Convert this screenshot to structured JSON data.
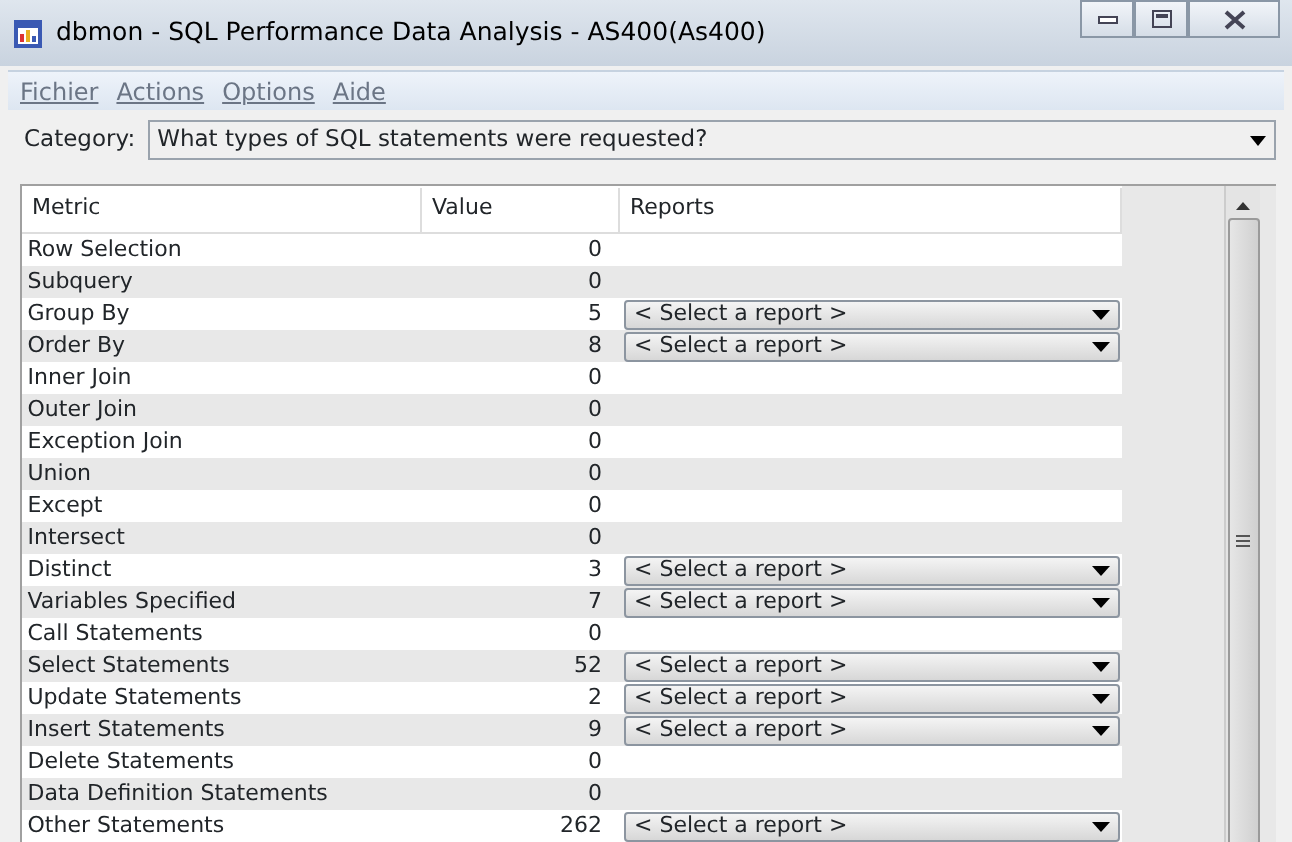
{
  "window": {
    "title": "dbmon - SQL Performance Data Analysis - AS400(As400)"
  },
  "menu": [
    {
      "label": "Fichier"
    },
    {
      "label": "Actions"
    },
    {
      "label": "Options"
    },
    {
      "label": "Aide"
    }
  ],
  "category": {
    "label": "Category:",
    "value": "What types of SQL statements were requested?"
  },
  "table": {
    "columns": [
      "Metric",
      "Value",
      "Reports"
    ],
    "rows": [
      {
        "metric": "Row Selection",
        "value": "0"
      },
      {
        "metric": "Subquery",
        "value": "0"
      },
      {
        "metric": "Group By",
        "value": "5",
        "report": "< Select a report >"
      },
      {
        "metric": "Order By",
        "value": "8",
        "report": "< Select a report >"
      },
      {
        "metric": "Inner Join",
        "value": "0"
      },
      {
        "metric": "Outer Join",
        "value": "0"
      },
      {
        "metric": "Exception Join",
        "value": "0"
      },
      {
        "metric": "Union",
        "value": "0"
      },
      {
        "metric": "Except",
        "value": "0"
      },
      {
        "metric": "Intersect",
        "value": "0"
      },
      {
        "metric": "Distinct",
        "value": "3",
        "report": "< Select a report >"
      },
      {
        "metric": "Variables Specified",
        "value": "7",
        "report": "< Select a report >"
      },
      {
        "metric": "Call Statements",
        "value": "0"
      },
      {
        "metric": "Select Statements",
        "value": "52",
        "report": "< Select a report >"
      },
      {
        "metric": "Update Statements",
        "value": "2",
        "report": "< Select a report >"
      },
      {
        "metric": "Insert Statements",
        "value": "9",
        "report": "< Select a report >"
      },
      {
        "metric": "Delete Statements",
        "value": "0"
      },
      {
        "metric": "Data Definition Statements",
        "value": "0"
      },
      {
        "metric": "Other Statements",
        "value": "262",
        "report": "< Select a report >"
      }
    ]
  }
}
